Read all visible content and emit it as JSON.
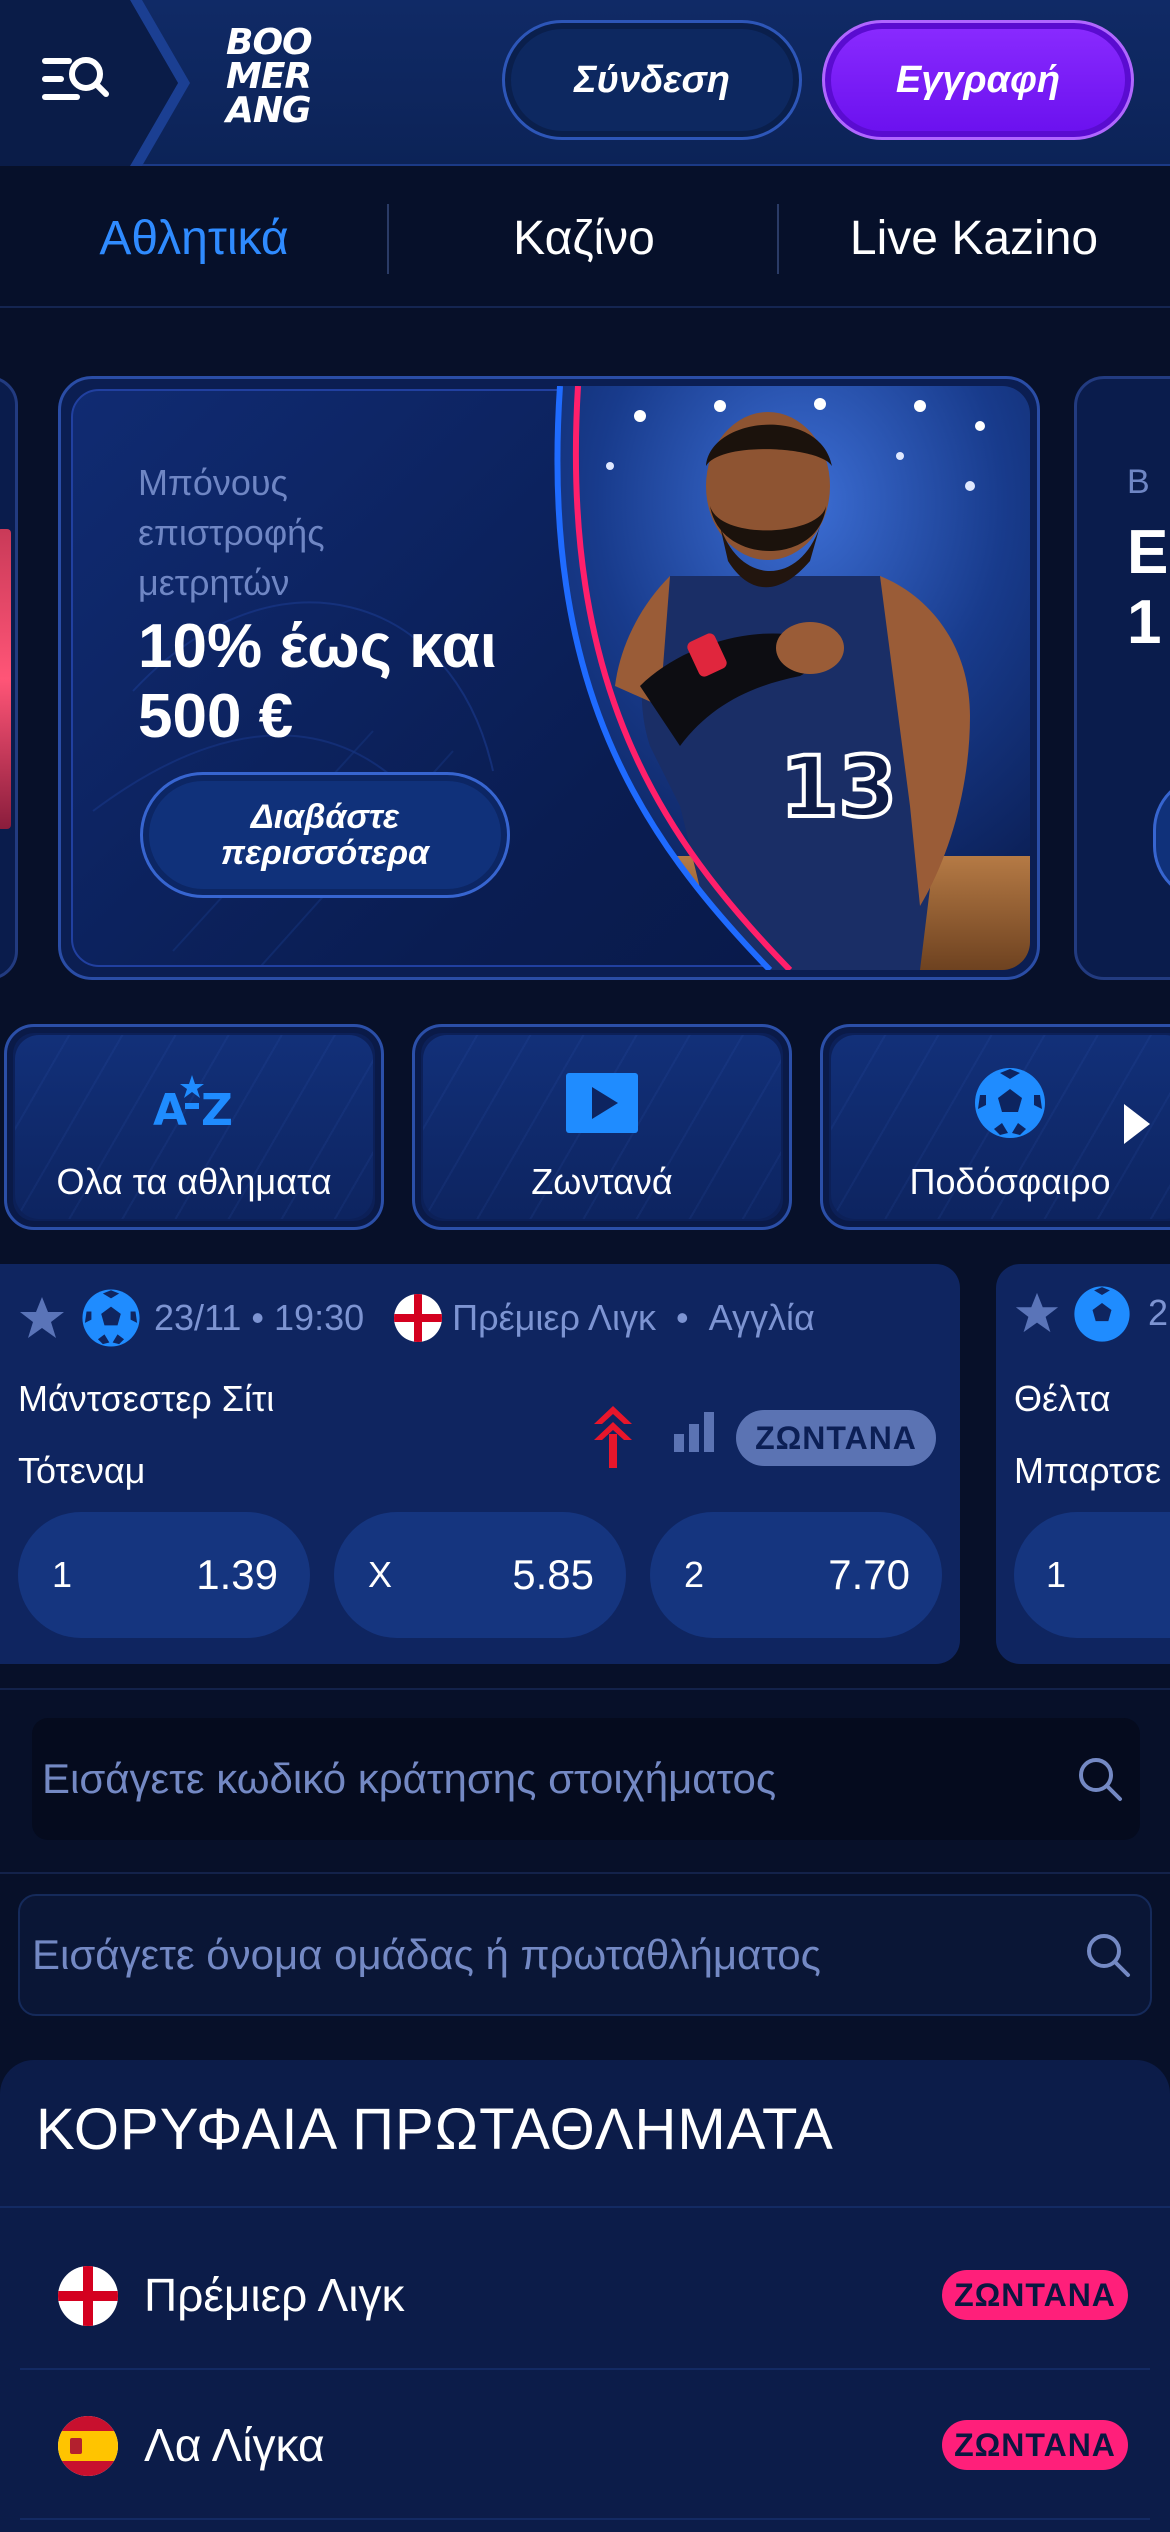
{
  "header": {
    "logo_lines": [
      "BOO",
      "MER",
      "ANG"
    ],
    "login_label": "Σύνδεση",
    "register_label": "Εγγραφή",
    "accent_register": "#7a1cff"
  },
  "nav": {
    "tabs": [
      {
        "label": "Αθλητικά",
        "active": true
      },
      {
        "label": "Καζίνο",
        "active": false
      },
      {
        "label": "Live Kazino",
        "active": false
      }
    ]
  },
  "promo": {
    "subtitle": "Μπόνους επιστροφής μετρητών",
    "title": "10% έως και 500 €",
    "button_label": "Διαβάστε περισσότερα",
    "next_peek_subtitle": "Β",
    "next_peek_title_1": "Ε",
    "next_peek_title_2": "1",
    "jersey_number": "13"
  },
  "categories": [
    {
      "label": "Ολα τα αθληματα",
      "icon": "a-z-icon"
    },
    {
      "label": "Ζωντανά",
      "icon": "play-icon"
    },
    {
      "label": "Ποδόσφαιρο",
      "icon": "soccer-ball-icon"
    }
  ],
  "match": {
    "datetime": "23/11 • 19:30",
    "league": "Πρέμιερ Λιγκ",
    "country": "Αγγλία",
    "home": "Μάντσεστερ Σίτι",
    "away": "Τότεναμ",
    "live_label": "ΖΩΝΤΑΝΑ",
    "odds": [
      {
        "label": "1",
        "value": "1.39"
      },
      {
        "label": "X",
        "value": "5.85"
      },
      {
        "label": "2",
        "value": "7.70"
      }
    ]
  },
  "match2": {
    "datetime_peek": "2",
    "home": "Θέλτα",
    "away": "Μπαρτσε",
    "odd_label": "1"
  },
  "search": {
    "booking_placeholder": "Εισάγετε κωδικό κράτησης στοιχήματος",
    "team_placeholder": "Εισάγετε όνομα ομάδας ή πρωταθλήματος"
  },
  "leagues": {
    "title": "ΚΟΡΥΦΑΙΑ ΠΡΩΤΑΘΛΗΜΑΤΑ",
    "items": [
      {
        "name": "Πρέμιερ Λιγκ",
        "badge": "ΖΩΝΤΑΝΑ",
        "flag": "england-flag-icon"
      },
      {
        "name": "Λα Λίγκα",
        "badge": "ΖΩΝΤΑΝΑ",
        "flag": "spain-flag-icon"
      }
    ]
  },
  "colors": {
    "background": "#071029",
    "accent_blue": "#2f8bff",
    "live_pink": "#ff1f7a"
  }
}
